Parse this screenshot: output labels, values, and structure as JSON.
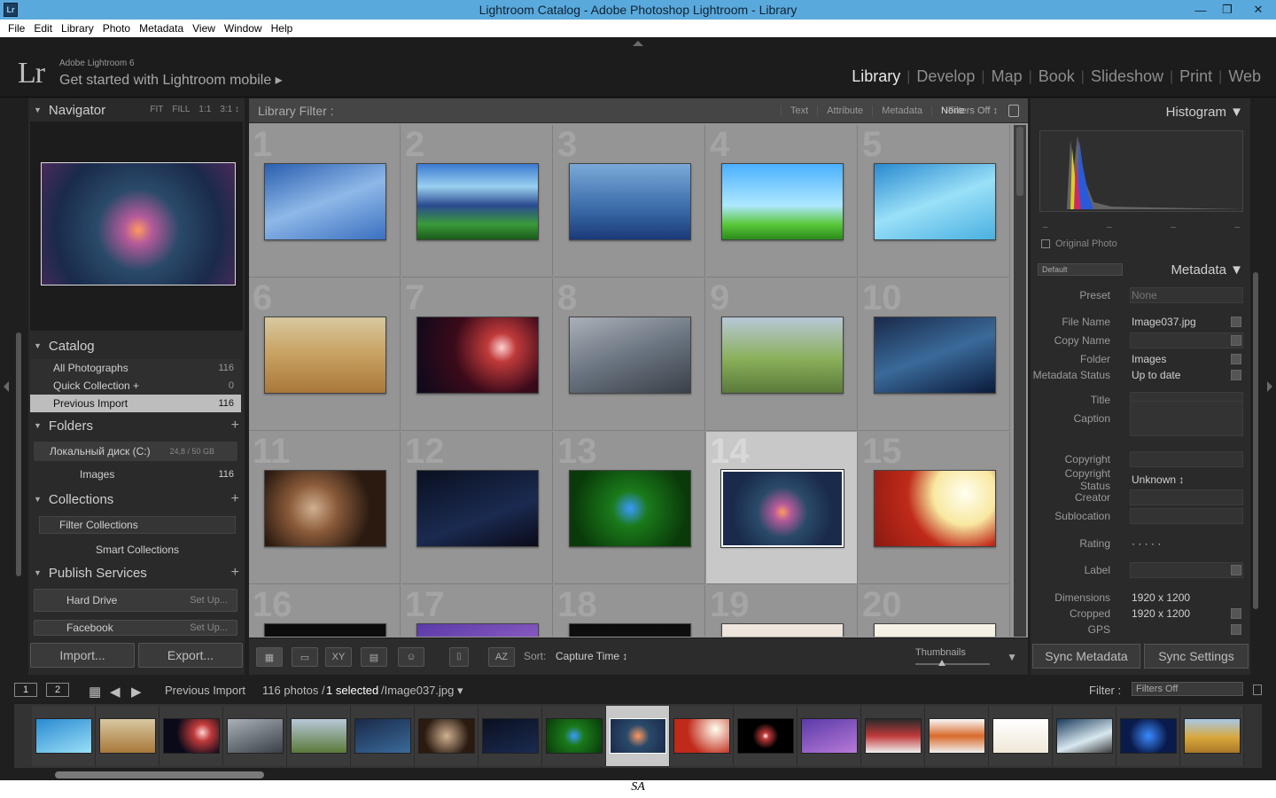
{
  "window": {
    "title": "Lightroom Catalog - Adobe Photoshop Lightroom - Library",
    "app_icon": "Lr",
    "minimize": "—",
    "restore": "❒",
    "close": "✕"
  },
  "menu": [
    "File",
    "Edit",
    "Library",
    "Photo",
    "Metadata",
    "View",
    "Window",
    "Help"
  ],
  "identity": {
    "logo": "Lr",
    "brand": "Adobe Lightroom 6",
    "mobile": "Get started with Lightroom mobile ▸"
  },
  "modules": [
    {
      "label": "Library",
      "active": true
    },
    {
      "label": "Develop",
      "active": false
    },
    {
      "label": "Map",
      "active": false
    },
    {
      "label": "Book",
      "active": false
    },
    {
      "label": "Slideshow",
      "active": false
    },
    {
      "label": "Print",
      "active": false
    },
    {
      "label": "Web",
      "active": false
    }
  ],
  "left": {
    "navigator": {
      "title": "Navigator",
      "opts": [
        "FIT",
        "FILL",
        "1:1",
        "3:1 ↕"
      ]
    },
    "catalog": {
      "title": "Catalog",
      "items": [
        {
          "label": "All Photographs",
          "count": "116"
        },
        {
          "label": "Quick Collection +",
          "count": "0"
        },
        {
          "label": "Previous Import",
          "count": "116"
        }
      ]
    },
    "folders": {
      "title": "Folders",
      "drive": "Локальный диск (C:)",
      "drive_size": "24,8 / 50 GB",
      "images_label": "Images",
      "images_count": "116"
    },
    "collections": {
      "title": "Collections",
      "filter": "Filter Collections",
      "smart": "Smart Collections"
    },
    "publish": {
      "title": "Publish Services",
      "items": [
        {
          "label": "Hard Drive",
          "setup": "Set Up..."
        },
        {
          "label": "Facebook",
          "setup": "Set Up..."
        }
      ]
    },
    "import_label": "Import...",
    "export_label": "Export..."
  },
  "filter_bar": {
    "label": "Library Filter :",
    "options": [
      "Text",
      "Attribute",
      "Metadata",
      "None"
    ],
    "active": "None",
    "filters_off": "Filters Off ↕"
  },
  "grid": {
    "numbers": [
      "1",
      "2",
      "3",
      "4",
      "5",
      "6",
      "7",
      "8",
      "9",
      "10",
      "11",
      "12",
      "13",
      "14",
      "15",
      "16",
      "17",
      "18",
      "19",
      "20"
    ],
    "selected_index": 13,
    "thumb_colors": [
      "linear-gradient(160deg,#2a5fb0,#8fb8e8 50%,#3a70c0)",
      "linear-gradient(180deg,#3a7ad0 0%,#9ad0f0 30%,#2a4a90 55%,#3a9a3a 80%,#1a5a1a)",
      "linear-gradient(180deg,#7aaad8,#3a6aa8 60%,#1a3a78)",
      "linear-gradient(180deg,#4ab0ff,#aee8ff 55%,#5ac83a 80%,#2a8a1a)",
      "linear-gradient(160deg,#2a8ad0,#9ae0f8 50%,#4ab0e0)",
      "linear-gradient(180deg,#d8c8a0,#c8a060 50%,#a8783a)",
      "radial-gradient(circle at 70% 40%,#ffd0d0 0,#c03a3a 15%,#3a0a1a 50%,#0a0a1a)",
      "linear-gradient(160deg,#aab0b8,#6a7480 50%,#3a4048)",
      "linear-gradient(180deg,#b8c8d8,#8ab05a 55%,#5a7a3a)",
      "linear-gradient(160deg,#1a2a4a,#3a6a9a 50%,#0a1a3a)",
      "radial-gradient(circle at 40% 50%,#d0b090 0,#8a5a3a 30%,#2a1a10 70%)",
      "linear-gradient(160deg,#0a1020,#1a2a50 60%,#0a0a18)",
      "radial-gradient(circle at 50% 50%,#3a9aff 0,#1a7a1a 25%,#0a3a0a 80%)",
      "radial-gradient(circle at 50% 55%,#ff9960 0,#b35a9a 12%,#2a4a6a 35%,#1a2a4a 70%)",
      "radial-gradient(circle at 75% 30%,#fffff0 0,#f8e8a0 30%,#c02a1a 55%,#8a1a10)",
      "linear-gradient(180deg,#0a0a0a,#1a1a1a)",
      "linear-gradient(160deg,#5a3aa8,#b87ad8)",
      "linear-gradient(180deg,#0a0a0a,#2a2a2a)",
      "linear-gradient(180deg,#f0e8e0,#d8c8b8)",
      "linear-gradient(180deg,#f8f4e8,#d8d0b8)"
    ]
  },
  "toolbar": {
    "sort_label": "Sort:",
    "sort_value": "Capture Time ↕",
    "thumbs_label": "Thumbnails"
  },
  "right": {
    "histogram": "Histogram ▼",
    "original_photo": "Original Photo",
    "hist_dashes": [
      "–",
      "–",
      "–",
      "–"
    ],
    "preset_select": "Default",
    "metadata_title": "Metadata ▼",
    "rows": [
      {
        "key": "Preset",
        "value": "None"
      },
      {
        "key": "File Name",
        "value": "Image037.jpg"
      },
      {
        "key": "Copy Name",
        "value": ""
      },
      {
        "key": "Folder",
        "value": "Images"
      },
      {
        "key": "Metadata Status",
        "value": "Up to date"
      },
      {
        "key": "Title",
        "value": ""
      },
      {
        "key": "Caption",
        "value": ""
      },
      {
        "key": "Copyright",
        "value": ""
      },
      {
        "key": "Copyright Status",
        "value": "Unknown ↕"
      },
      {
        "key": "Creator",
        "value": ""
      },
      {
        "key": "Sublocation",
        "value": ""
      },
      {
        "key": "Rating",
        "value": "· · · · ·"
      },
      {
        "key": "Label",
        "value": ""
      },
      {
        "key": "Dimensions",
        "value": "1920 x 1200"
      },
      {
        "key": "Cropped",
        "value": "1920 x 1200"
      },
      {
        "key": "GPS",
        "value": ""
      }
    ],
    "sync_metadata": "Sync Metadata",
    "sync_settings": "Sync Settings"
  },
  "filmstrip_bar": {
    "screen1": "1",
    "screen2": "2",
    "source": "Previous Import",
    "count": "116 photos /",
    "selected": "1 selected",
    "file": "/Image037.jpg ▾",
    "filter_label": "Filter :",
    "filter_value": "Filters Off"
  },
  "filmstrip_colors": [
    "linear-gradient(160deg,#2a8ad0,#9ae0f8)",
    "linear-gradient(180deg,#d8c8a0,#a8783a)",
    "radial-gradient(circle at 70% 40%,#ffd0d0,#c03a3a 20%,#0a0a1a 60%)",
    "linear-gradient(160deg,#aab0b8,#3a4048)",
    "linear-gradient(180deg,#b8c8d8,#5a7a3a)",
    "linear-gradient(160deg,#1a2a4a,#3a6a9a)",
    "radial-gradient(circle,#d0b090,#2a1a10 70%)",
    "linear-gradient(160deg,#0a1020,#1a2a50)",
    "radial-gradient(circle,#3a9aff,#1a7a1a 30%,#0a3a0a)",
    "radial-gradient(circle,#ff9960,#2a4a6a 35%,#1a2a4a)",
    "radial-gradient(circle at 75% 30%,#fffff0,#c02a1a 60%)",
    "radial-gradient(circle,#ffffff,#c03a3a 10%,#000 40%)",
    "linear-gradient(160deg,#5a3aa8,#b87ad8)",
    "linear-gradient(180deg,#2a2a2a,#c03a3a 50%,#f0f0f0)",
    "linear-gradient(180deg,#f8f8f8,#d86a2a 50%,#f0f0f0)",
    "linear-gradient(180deg,#ffffff,#f0e8d8)",
    "linear-gradient(160deg,#1a3a5a,#d8e8f0 60%,#3a3a3a)",
    "radial-gradient(circle,#3a8aff,#0a1a4a 60%)",
    "linear-gradient(180deg,#a8c8e8,#d8a83a 55%,#a8782a)"
  ],
  "footer": "SA"
}
